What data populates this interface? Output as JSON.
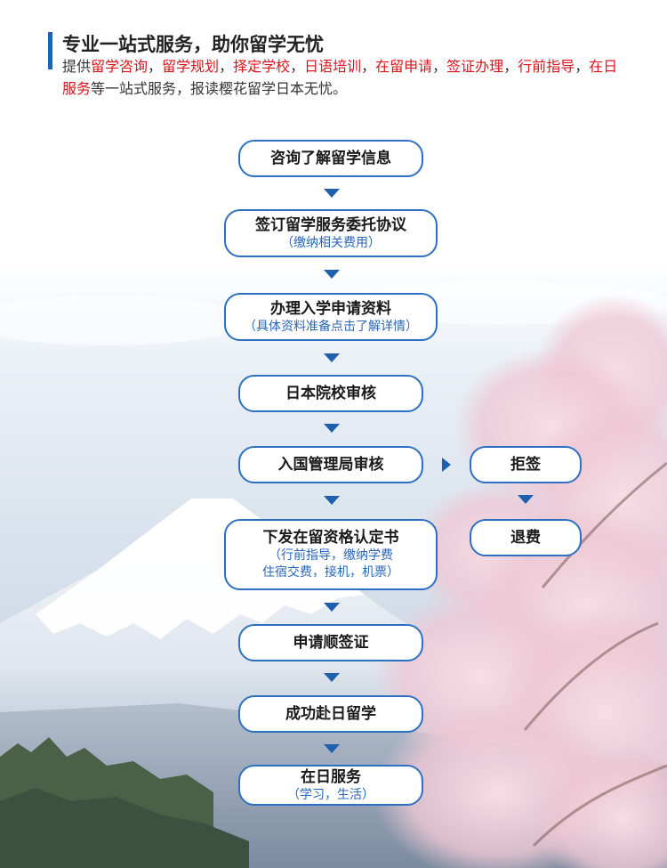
{
  "header": {
    "title": "专业一站式服务，助你留学无忧",
    "desc_prefix": "提供",
    "services": [
      "留学咨询",
      "留学规划",
      "择定学校",
      "日语培训",
      "在留申请",
      "签证办理",
      "行前指导",
      "在日服务"
    ],
    "separator": "，",
    "desc_suffix": "等一站式服务，报读樱花留学日本无忧。"
  },
  "flow": {
    "step1": {
      "title": "咨询了解留学信息"
    },
    "step2": {
      "title": "签订留学服务委托协议",
      "sub": "（缴纳相关费用）"
    },
    "step3": {
      "title": "办理入学申请资料",
      "sub": "（具体资料准备点击了解详情）"
    },
    "step4": {
      "title": "日本院校审核"
    },
    "step5": {
      "title": "入国管理局审核"
    },
    "step6": {
      "title": "下发在留资格认定书",
      "sub1": "（行前指导，缴纳学费",
      "sub2": "住宿交费，接机，机票）"
    },
    "step7": {
      "title": "申请顺签证"
    },
    "step8": {
      "title": "成功赴日留学"
    },
    "step9": {
      "title": "在日服务",
      "sub": "（学习，生活）"
    },
    "branch1": {
      "title": "拒签"
    },
    "branch2": {
      "title": "退费"
    }
  },
  "colors": {
    "accent": "#1e63b4",
    "highlight": "#d9141d",
    "box_border": "#2d6fc0",
    "arrow": "#1e5fae"
  }
}
